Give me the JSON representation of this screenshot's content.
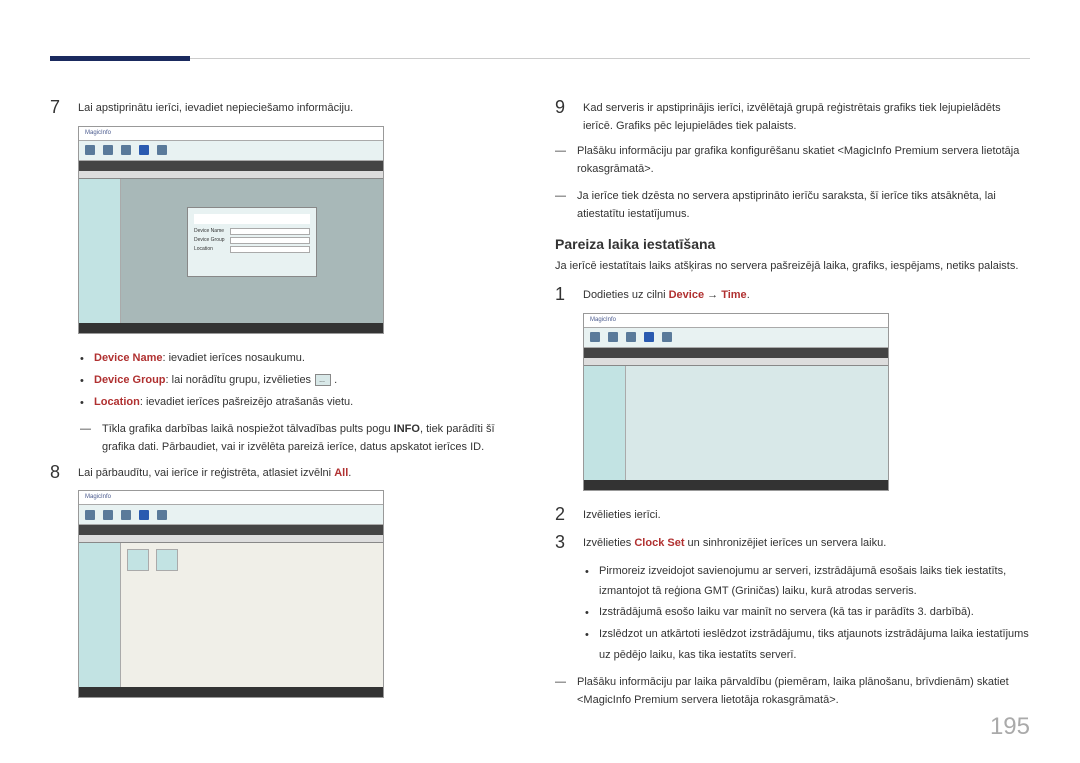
{
  "header_accent_color": "#1a2a5e",
  "left": {
    "step7": {
      "num": "7",
      "text": "Lai apstiprinātu ierīci, ievadiet nepieciešamo informāciju."
    },
    "screenshot1_app": "MagicInfo",
    "bullets": {
      "device_name_label": "Device Name",
      "device_name_text": ": ievadiet ierīces nosaukumu.",
      "device_group_label": "Device Group",
      "device_group_text": ": lai norādītu grupu, izvēlieties",
      "location_label": "Location",
      "location_text": ": ievadiet ierīces pašreizējo atrašanās vietu."
    },
    "dash_note": {
      "text_before": "Tīkla grafika darbības laikā nospiežot tālvadības pults pogu ",
      "info": "INFO",
      "text_after": ", tiek parādīti šī grafika dati. Pārbaudiet, vai ir izvēlēta pareizā ierīce, datus apskatot ierīces ID."
    },
    "step8": {
      "num": "8",
      "text_before": "Lai pārbaudītu, vai ierīce ir reģistrēta, atlasiet izvēlni ",
      "all": "All",
      "text_after": "."
    }
  },
  "right": {
    "step9": {
      "num": "9",
      "text": "Kad serveris ir apstiprinājis ierīci, izvēlētajā grupā reģistrētais grafiks tiek lejupielādēts ierīcē. Grafiks pēc lejupielādes tiek palaists."
    },
    "dash1": "Plašāku informāciju par grafika konfigurēšanu skatiet <MagicInfo Premium servera lietotāja rokasgrāmatā>.",
    "dash2": "Ja ierīce tiek dzēsta no servera apstiprināto ierīču saraksta, šī ierīce tiks atsāknēta, lai atiestatītu iestatījumus.",
    "section_title": "Pareiza laika iestatīšana",
    "section_desc": "Ja ierīcē iestatītais laiks atšķiras no servera pašreizējā laika, grafiks, iespējams, netiks palaists.",
    "step1": {
      "num": "1",
      "text_before": "Dodieties uz cilni ",
      "device": "Device",
      "arrow": " → ",
      "time": "Time",
      "text_after": "."
    },
    "step2": {
      "num": "2",
      "text": "Izvēlieties ierīci."
    },
    "step3": {
      "num": "3",
      "text_before": "Izvēlieties ",
      "clock_set": "Clock Set",
      "text_after": " un sinhronizējiet ierīces un servera laiku."
    },
    "bullets": {
      "b1": "Pirmoreiz izveidojot savienojumu ar serveri, izstrādājumā esošais laiks tiek iestatīts, izmantojot tā reģiona GMT (Griničas) laiku, kurā atrodas serveris.",
      "b2": "Izstrādājumā esošo laiku var mainīt no servera (kā tas ir parādīts 3. darbībā).",
      "b3": "Izslēdzot un atkārtoti ieslēdzot izstrādājumu, tiks atjaunots izstrādājuma laika iestatījums uz pēdējo laiku, kas tika iestatīts serverī."
    },
    "dash3": "Plašāku informāciju par laika pārvaldību (piemēram, laika plānošanu, brīvdienām) skatiet <MagicInfo Premium servera lietotāja rokasgrāmatā>."
  },
  "page_number": "195"
}
